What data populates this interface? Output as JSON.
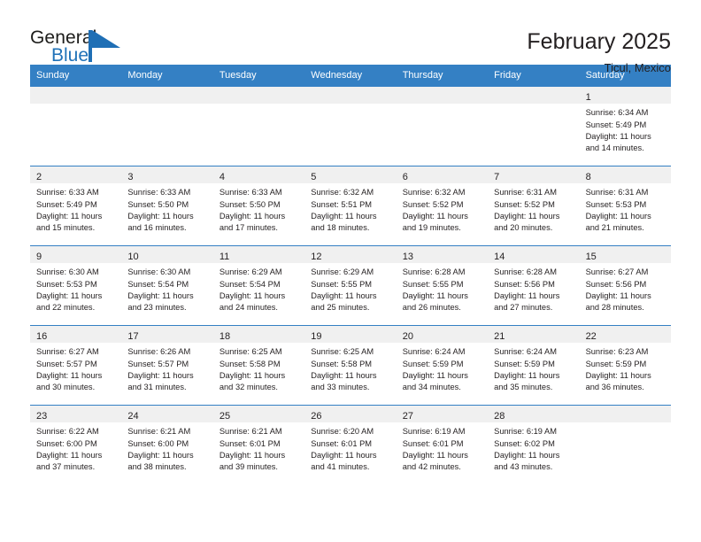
{
  "brand": {
    "name_part1": "General",
    "name_part2": "Blue"
  },
  "header": {
    "title": "February 2025",
    "location": "Ticul, Mexico"
  },
  "weekdays": [
    "Sunday",
    "Monday",
    "Tuesday",
    "Wednesday",
    "Thursday",
    "Friday",
    "Saturday"
  ],
  "colors": {
    "header_blue": "#3480c4",
    "brand_blue": "#2072b8",
    "day_band_gray": "#f0f0f0",
    "text": "#231f20"
  },
  "weeks": [
    [
      {
        "empty": true
      },
      {
        "empty": true
      },
      {
        "empty": true
      },
      {
        "empty": true
      },
      {
        "empty": true
      },
      {
        "empty": true
      },
      {
        "day": "1",
        "sunrise": "Sunrise: 6:34 AM",
        "sunset": "Sunset: 5:49 PM",
        "daylight_line1": "Daylight: 11 hours",
        "daylight_line2": "and 14 minutes."
      }
    ],
    [
      {
        "day": "2",
        "sunrise": "Sunrise: 6:33 AM",
        "sunset": "Sunset: 5:49 PM",
        "daylight_line1": "Daylight: 11 hours",
        "daylight_line2": "and 15 minutes."
      },
      {
        "day": "3",
        "sunrise": "Sunrise: 6:33 AM",
        "sunset": "Sunset: 5:50 PM",
        "daylight_line1": "Daylight: 11 hours",
        "daylight_line2": "and 16 minutes."
      },
      {
        "day": "4",
        "sunrise": "Sunrise: 6:33 AM",
        "sunset": "Sunset: 5:50 PM",
        "daylight_line1": "Daylight: 11 hours",
        "daylight_line2": "and 17 minutes."
      },
      {
        "day": "5",
        "sunrise": "Sunrise: 6:32 AM",
        "sunset": "Sunset: 5:51 PM",
        "daylight_line1": "Daylight: 11 hours",
        "daylight_line2": "and 18 minutes."
      },
      {
        "day": "6",
        "sunrise": "Sunrise: 6:32 AM",
        "sunset": "Sunset: 5:52 PM",
        "daylight_line1": "Daylight: 11 hours",
        "daylight_line2": "and 19 minutes."
      },
      {
        "day": "7",
        "sunrise": "Sunrise: 6:31 AM",
        "sunset": "Sunset: 5:52 PM",
        "daylight_line1": "Daylight: 11 hours",
        "daylight_line2": "and 20 minutes."
      },
      {
        "day": "8",
        "sunrise": "Sunrise: 6:31 AM",
        "sunset": "Sunset: 5:53 PM",
        "daylight_line1": "Daylight: 11 hours",
        "daylight_line2": "and 21 minutes."
      }
    ],
    [
      {
        "day": "9",
        "sunrise": "Sunrise: 6:30 AM",
        "sunset": "Sunset: 5:53 PM",
        "daylight_line1": "Daylight: 11 hours",
        "daylight_line2": "and 22 minutes."
      },
      {
        "day": "10",
        "sunrise": "Sunrise: 6:30 AM",
        "sunset": "Sunset: 5:54 PM",
        "daylight_line1": "Daylight: 11 hours",
        "daylight_line2": "and 23 minutes."
      },
      {
        "day": "11",
        "sunrise": "Sunrise: 6:29 AM",
        "sunset": "Sunset: 5:54 PM",
        "daylight_line1": "Daylight: 11 hours",
        "daylight_line2": "and 24 minutes."
      },
      {
        "day": "12",
        "sunrise": "Sunrise: 6:29 AM",
        "sunset": "Sunset: 5:55 PM",
        "daylight_line1": "Daylight: 11 hours",
        "daylight_line2": "and 25 minutes."
      },
      {
        "day": "13",
        "sunrise": "Sunrise: 6:28 AM",
        "sunset": "Sunset: 5:55 PM",
        "daylight_line1": "Daylight: 11 hours",
        "daylight_line2": "and 26 minutes."
      },
      {
        "day": "14",
        "sunrise": "Sunrise: 6:28 AM",
        "sunset": "Sunset: 5:56 PM",
        "daylight_line1": "Daylight: 11 hours",
        "daylight_line2": "and 27 minutes."
      },
      {
        "day": "15",
        "sunrise": "Sunrise: 6:27 AM",
        "sunset": "Sunset: 5:56 PM",
        "daylight_line1": "Daylight: 11 hours",
        "daylight_line2": "and 28 minutes."
      }
    ],
    [
      {
        "day": "16",
        "sunrise": "Sunrise: 6:27 AM",
        "sunset": "Sunset: 5:57 PM",
        "daylight_line1": "Daylight: 11 hours",
        "daylight_line2": "and 30 minutes."
      },
      {
        "day": "17",
        "sunrise": "Sunrise: 6:26 AM",
        "sunset": "Sunset: 5:57 PM",
        "daylight_line1": "Daylight: 11 hours",
        "daylight_line2": "and 31 minutes."
      },
      {
        "day": "18",
        "sunrise": "Sunrise: 6:25 AM",
        "sunset": "Sunset: 5:58 PM",
        "daylight_line1": "Daylight: 11 hours",
        "daylight_line2": "and 32 minutes."
      },
      {
        "day": "19",
        "sunrise": "Sunrise: 6:25 AM",
        "sunset": "Sunset: 5:58 PM",
        "daylight_line1": "Daylight: 11 hours",
        "daylight_line2": "and 33 minutes."
      },
      {
        "day": "20",
        "sunrise": "Sunrise: 6:24 AM",
        "sunset": "Sunset: 5:59 PM",
        "daylight_line1": "Daylight: 11 hours",
        "daylight_line2": "and 34 minutes."
      },
      {
        "day": "21",
        "sunrise": "Sunrise: 6:24 AM",
        "sunset": "Sunset: 5:59 PM",
        "daylight_line1": "Daylight: 11 hours",
        "daylight_line2": "and 35 minutes."
      },
      {
        "day": "22",
        "sunrise": "Sunrise: 6:23 AM",
        "sunset": "Sunset: 5:59 PM",
        "daylight_line1": "Daylight: 11 hours",
        "daylight_line2": "and 36 minutes."
      }
    ],
    [
      {
        "day": "23",
        "sunrise": "Sunrise: 6:22 AM",
        "sunset": "Sunset: 6:00 PM",
        "daylight_line1": "Daylight: 11 hours",
        "daylight_line2": "and 37 minutes."
      },
      {
        "day": "24",
        "sunrise": "Sunrise: 6:21 AM",
        "sunset": "Sunset: 6:00 PM",
        "daylight_line1": "Daylight: 11 hours",
        "daylight_line2": "and 38 minutes."
      },
      {
        "day": "25",
        "sunrise": "Sunrise: 6:21 AM",
        "sunset": "Sunset: 6:01 PM",
        "daylight_line1": "Daylight: 11 hours",
        "daylight_line2": "and 39 minutes."
      },
      {
        "day": "26",
        "sunrise": "Sunrise: 6:20 AM",
        "sunset": "Sunset: 6:01 PM",
        "daylight_line1": "Daylight: 11 hours",
        "daylight_line2": "and 41 minutes."
      },
      {
        "day": "27",
        "sunrise": "Sunrise: 6:19 AM",
        "sunset": "Sunset: 6:01 PM",
        "daylight_line1": "Daylight: 11 hours",
        "daylight_line2": "and 42 minutes."
      },
      {
        "day": "28",
        "sunrise": "Sunrise: 6:19 AM",
        "sunset": "Sunset: 6:02 PM",
        "daylight_line1": "Daylight: 11 hours",
        "daylight_line2": "and 43 minutes."
      },
      {
        "empty": true
      }
    ]
  ]
}
